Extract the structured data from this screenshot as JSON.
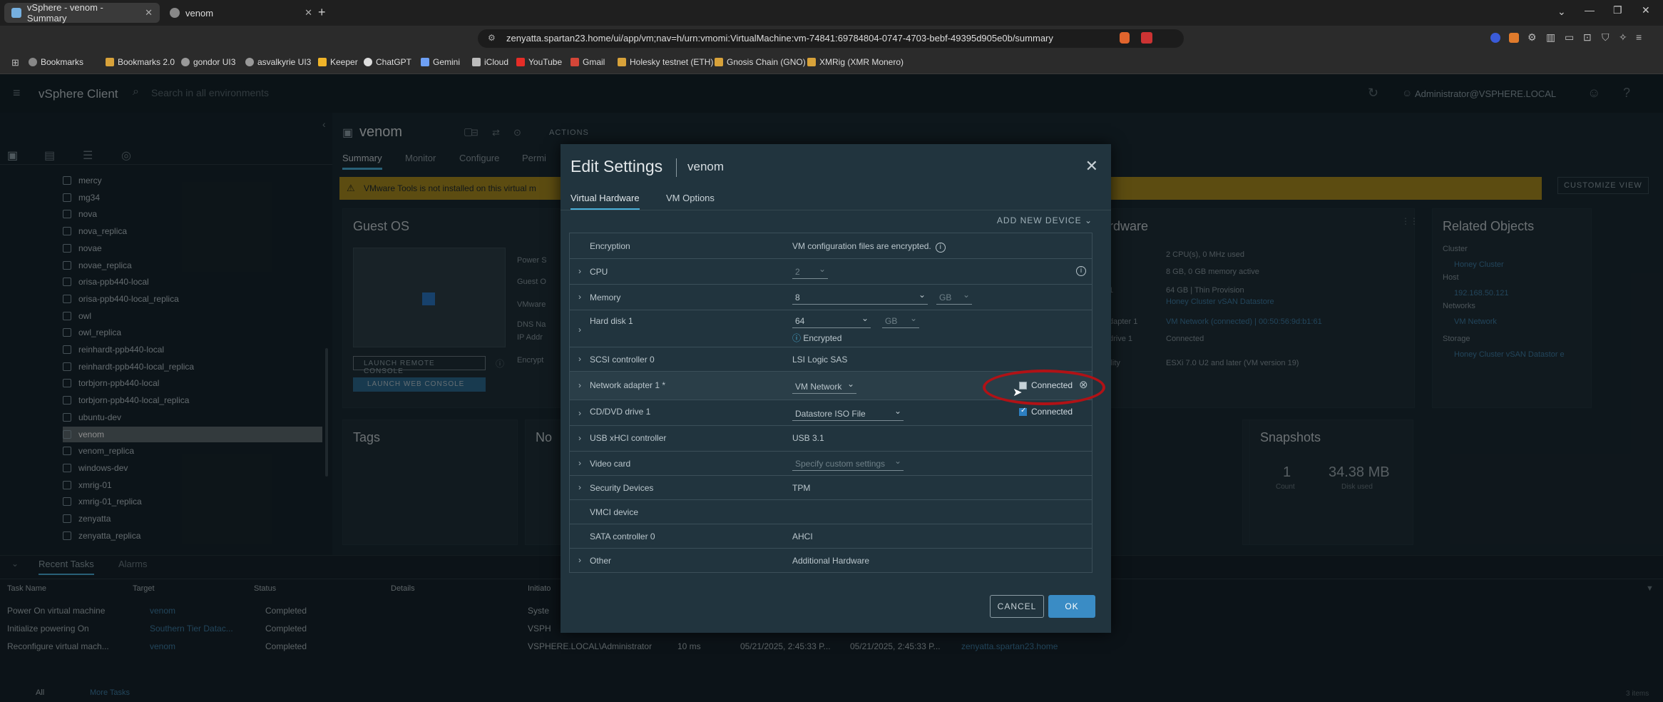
{
  "browser": {
    "tabs": [
      {
        "label": "vSphere - venom - Summary",
        "active": true
      },
      {
        "label": "venom",
        "active": false
      }
    ],
    "url": "zenyatta.spartan23.home/ui/app/vm;nav=h/urn:vmomi:VirtualMachine:vm-74841:69784804-0747-4703-bebf-49395d905e0b/summary",
    "bookmarks": [
      "Bookmarks",
      "Bookmarks 2.0",
      "gondor UI3",
      "asvalkyrie UI3",
      "Keeper",
      "ChatGPT",
      "Gemini",
      "iCloud",
      "YouTube",
      "Gmail",
      "Holesky testnet (ETH)",
      "Gnosis Chain (GNO)",
      "XMRig (XMR Monero)"
    ]
  },
  "vsphere": {
    "app_title": "vSphere Client",
    "search_placeholder": "Search in all environments",
    "user": "Administrator@VSPHERE.LOCAL"
  },
  "tree": {
    "items": [
      "mercy",
      "mg34",
      "nova",
      "nova_replica",
      "novae",
      "novae_replica",
      "orisa-ppb440-local",
      "orisa-ppb440-local_replica",
      "owl",
      "owl_replica",
      "reinhardt-ppb440-local",
      "reinhardt-ppb440-local_replica",
      "torbjorn-ppb440-local",
      "torbjorn-ppb440-local_replica",
      "ubuntu-dev",
      "venom",
      "venom_replica",
      "windows-dev",
      "xmrig-01",
      "xmrig-01_replica",
      "zenyatta",
      "zenyatta_replica"
    ],
    "selected": "venom"
  },
  "vm_page": {
    "name": "venom",
    "actions": "ACTIONS",
    "tabs": [
      "Summary",
      "Monitor",
      "Configure",
      "Permi"
    ],
    "warning": "VMware Tools is not installed on this virtual m",
    "customize": "CUSTOMIZE VIEW",
    "guest_os": {
      "title": "Guest OS",
      "fields": [
        "Power S",
        "Guest O",
        "VMware",
        "DNS Na",
        "IP Addr",
        "Encrypt"
      ],
      "launch_remote": "LAUNCH REMOTE CONSOLE",
      "launch_web": "LAUNCH WEB CONSOLE"
    },
    "hardware": {
      "title": "rdware",
      "labels": [
        "1",
        "dapter 1",
        "drive 1",
        "ility"
      ],
      "values": [
        "2 CPU(s), 0 MHz used",
        "8 GB, 0 GB memory active",
        "64 GB | Thin Provision",
        "Honey Cluster vSAN Datastore",
        "VM Network (connected) | 00:50:56:9d:b1:61",
        "Connected",
        "ESXi 7.0 U2 and later (VM version 19)"
      ]
    },
    "related": {
      "title": "Related Objects",
      "cluster_label": "Cluster",
      "cluster": "Honey Cluster",
      "host_label": "Host",
      "host": "192.168.50.121",
      "networks_label": "Networks",
      "network": "VM Network",
      "storage_label": "Storage",
      "storage": "Honey Cluster vSAN Datastor e"
    },
    "tags_title": "Tags",
    "notes_title": "No",
    "snapshots": {
      "title": "Snapshots",
      "count": "1",
      "count_label": "Count",
      "size": "34.38 MB",
      "size_label": "Disk used"
    }
  },
  "tasks": {
    "tabs": [
      "Recent Tasks",
      "Alarms"
    ],
    "columns": [
      "Task Name",
      "Target",
      "Status",
      "Details",
      "Initiato"
    ],
    "rows": [
      {
        "name": "Power On virtual machine",
        "target": "venom",
        "status": "Completed",
        "details": "",
        "initiator": "Syste"
      },
      {
        "name": "Initialize powering On",
        "target": "Southern Tier Datac...",
        "status": "Completed",
        "details": "",
        "initiator": "VSPH"
      },
      {
        "name": "Reconfigure virtual mach...",
        "target": "venom",
        "status": "Completed",
        "details": "",
        "initiator": "VSPHERE.LOCAL\\Administrator",
        "queued": "10 ms",
        "start": "05/21/2025, 2:45:33 P...",
        "completion": "05/21/2025, 2:45:33 P...",
        "server": "zenyatta.spartan23.home"
      }
    ],
    "filter": "All",
    "more": "More Tasks",
    "items_count": "3 items"
  },
  "modal": {
    "title": "Edit Settings",
    "vm": "venom",
    "tabs": [
      "Virtual Hardware",
      "VM Options"
    ],
    "add_device": "ADD NEW DEVICE",
    "rows": {
      "encryption": {
        "label": "Encryption",
        "value": "VM configuration files are encrypted."
      },
      "cpu": {
        "label": "CPU",
        "value": "2"
      },
      "memory": {
        "label": "Memory",
        "value": "8",
        "unit": "GB"
      },
      "hard_disk": {
        "label": "Hard disk 1",
        "value": "64",
        "unit": "GB",
        "encrypted": "Encrypted"
      },
      "scsi": {
        "label": "SCSI controller 0",
        "value": "LSI Logic SAS"
      },
      "network": {
        "label": "Network adapter 1 *",
        "value": "VM Network",
        "connected": "Connected",
        "checked": false
      },
      "cddvd": {
        "label": "CD/DVD drive 1",
        "value": "Datastore ISO File",
        "connected": "Connected",
        "checked": true
      },
      "usb": {
        "label": "USB xHCI controller",
        "value": "USB 3.1"
      },
      "video": {
        "label": "Video card",
        "value": "Specify custom settings"
      },
      "security": {
        "label": "Security Devices",
        "value": "TPM"
      },
      "vmci": {
        "label": "VMCI device",
        "value": ""
      },
      "sata": {
        "label": "SATA controller 0",
        "value": "AHCI"
      },
      "other": {
        "label": "Other",
        "value": "Additional Hardware"
      }
    },
    "cancel": "CANCEL",
    "ok": "OK"
  },
  "colors": {
    "accent": "#49afd9",
    "ok_button": "#3a8cc5",
    "highlight": "#b11216",
    "warning": "#c9a227"
  }
}
